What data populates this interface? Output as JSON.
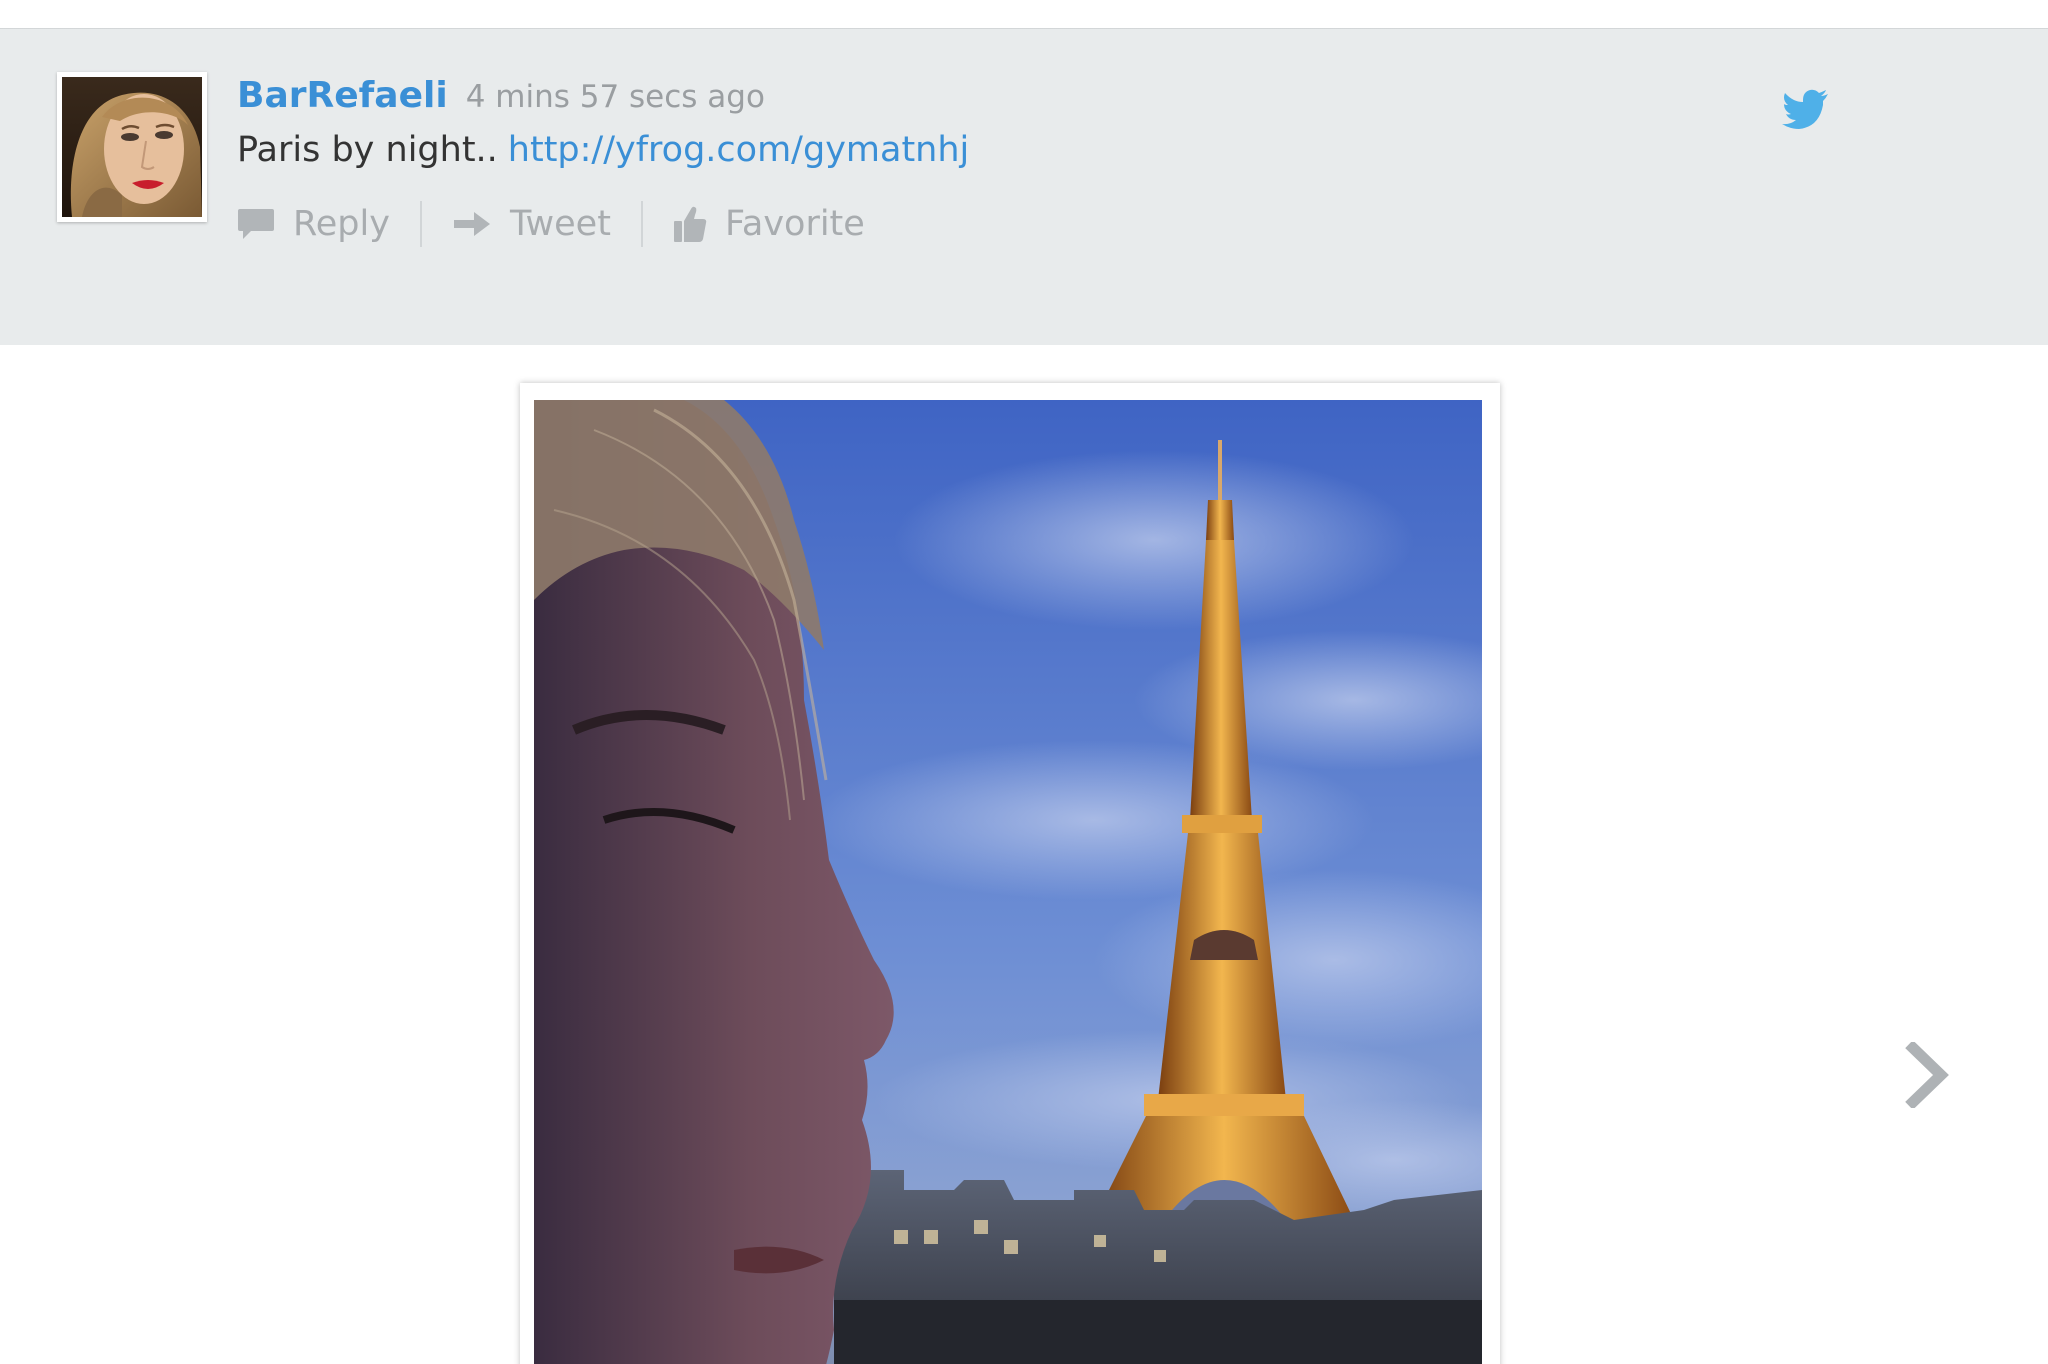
{
  "tweet": {
    "username": "BarRefaeli",
    "timestamp": "4 mins 57 secs ago",
    "text": "Paris by night..",
    "link": "http://yfrog.com/gymatnhj"
  },
  "actions": {
    "reply_label": "Reply",
    "tweet_label": "Tweet",
    "favorite_label": "Favorite"
  },
  "icons": {
    "reply": "speech-bubble-icon",
    "retweet": "arrow-right-icon",
    "favorite": "thumbs-up-icon",
    "service": "twitter-bird-icon",
    "next": "chevron-right-icon"
  },
  "colors": {
    "header_background": "#e8ebec",
    "username": "#3a8fd6",
    "link": "#3a8fd6",
    "twitter_bird": "#4fb0e8",
    "action_text": "#a8acaf"
  }
}
